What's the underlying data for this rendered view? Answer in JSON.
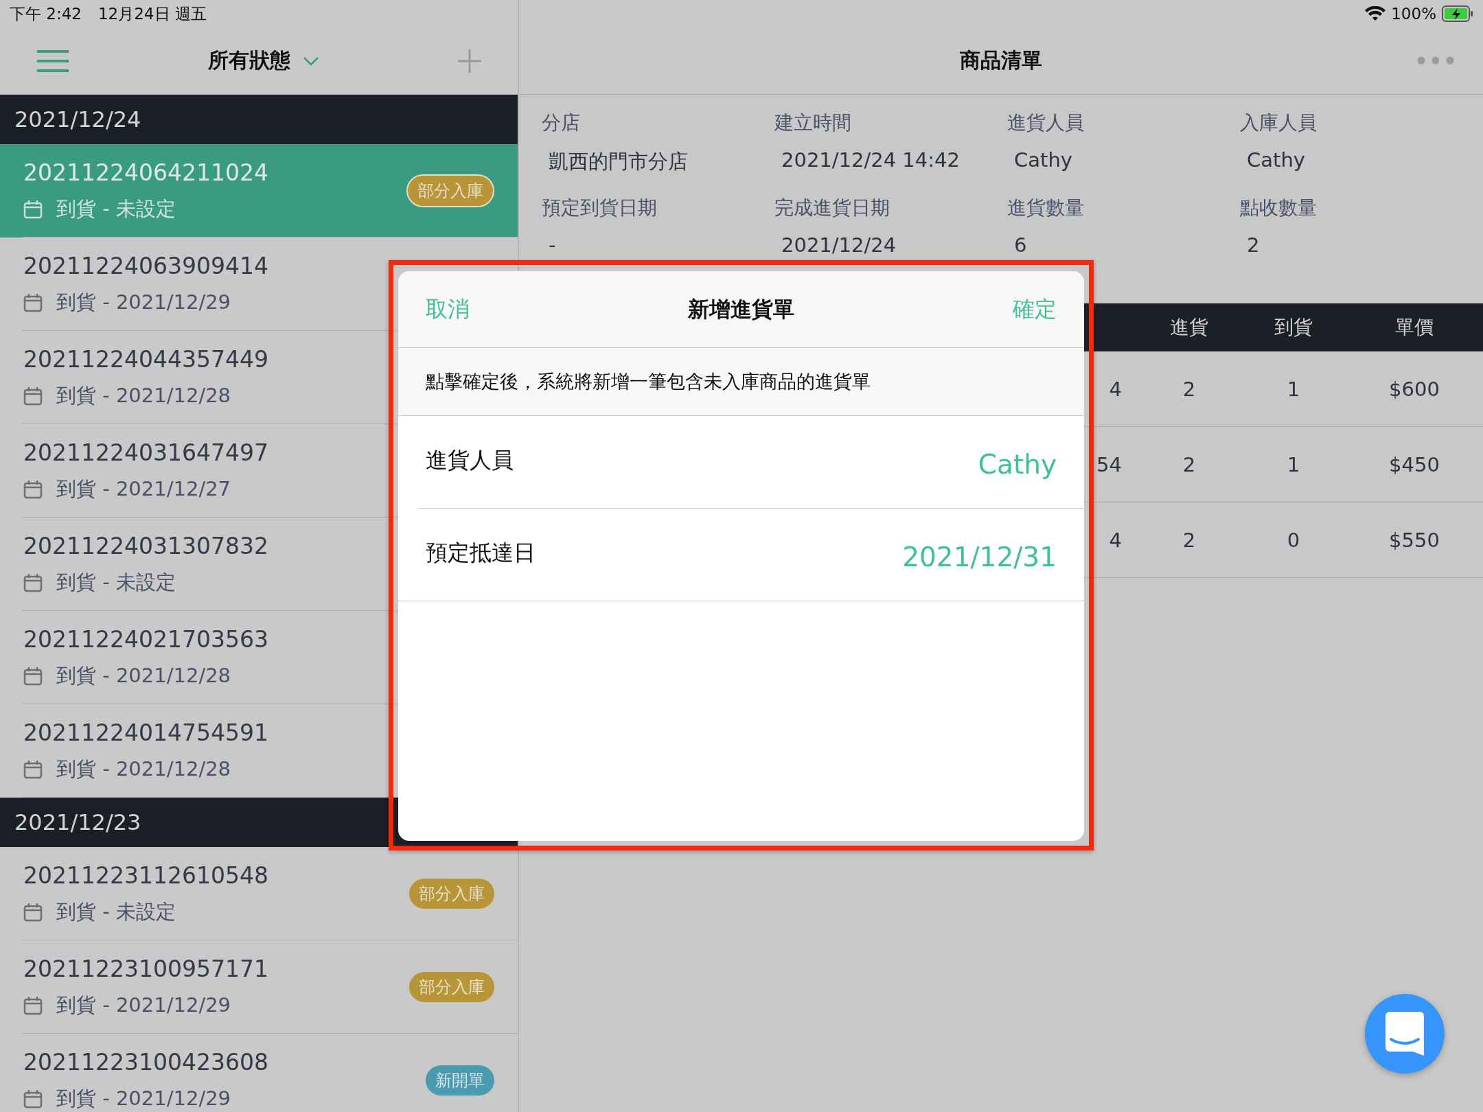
{
  "status_bar": {
    "time": "下午 2:42",
    "date": "12月24日 週五",
    "battery": "100%"
  },
  "sidebar": {
    "filter_title": "所有狀態",
    "sections": [
      {
        "date": "2021/12/24",
        "orders": [
          {
            "number": "20211224064211024",
            "arrival": "到貨 - 未設定",
            "badge": {
              "label": "部分入庫",
              "kind": "partial"
            },
            "selected": true
          },
          {
            "number": "20211224063909414",
            "arrival": "到貨 - 2021/12/29",
            "selected": false
          },
          {
            "number": "20211224044357449",
            "arrival": "到貨 - 2021/12/28",
            "selected": false
          },
          {
            "number": "20211224031647497",
            "arrival": "到貨 - 2021/12/27",
            "selected": false
          },
          {
            "number": "20211224031307832",
            "arrival": "到貨 - 未設定",
            "selected": false
          },
          {
            "number": "20211224021703563",
            "arrival": "到貨 - 2021/12/28",
            "selected": false
          },
          {
            "number": "20211224014754591",
            "arrival": "到貨 - 2021/12/28",
            "selected": false
          }
        ]
      },
      {
        "date": "2021/12/23",
        "orders": [
          {
            "number": "20211223112610548",
            "arrival": "到貨 - 未設定",
            "badge": {
              "label": "部分入庫",
              "kind": "partial"
            },
            "selected": false
          },
          {
            "number": "20211223100957171",
            "arrival": "到貨 - 2021/12/29",
            "badge": {
              "label": "部分入庫",
              "kind": "partial"
            },
            "selected": false
          },
          {
            "number": "20211223100423608",
            "arrival": "到貨 - 2021/12/29",
            "badge": {
              "label": "新開單",
              "kind": "new"
            },
            "selected": false
          }
        ]
      }
    ]
  },
  "detail": {
    "title": "商品清單",
    "fields": [
      {
        "label": "分店",
        "value": "凱西的門市分店"
      },
      {
        "label": "建立時間",
        "value": "2021/12/24 14:42"
      },
      {
        "label": "進貨人員",
        "value": "Cathy"
      },
      {
        "label": "入庫人員",
        "value": "Cathy"
      },
      {
        "label": "預定到貨日期",
        "value": "-"
      },
      {
        "label": "完成進貨日期",
        "value": "2021/12/24"
      },
      {
        "label": "進貨數量",
        "value": "6"
      },
      {
        "label": "點收數量",
        "value": "2"
      }
    ],
    "table": {
      "columns": [
        "進貨",
        "到貨",
        "單價"
      ],
      "rows": [
        {
          "column_1": "4",
          "cells": [
            "2",
            "1",
            "$600"
          ]
        },
        {
          "column_1": "54",
          "cells": [
            "2",
            "1",
            "$450"
          ]
        },
        {
          "column_1": "4",
          "cells": [
            "2",
            "0",
            "$550"
          ]
        }
      ]
    }
  },
  "modal": {
    "cancel": "取消",
    "title": "新增進貨單",
    "confirm": "確定",
    "description": "點擊確定後，系統將新增一筆包含未入庫商品的進貨單",
    "fields": [
      {
        "label": "進貨人員",
        "value": "Cathy"
      },
      {
        "label": "預定抵達日",
        "value": "2021/12/31"
      }
    ]
  }
}
